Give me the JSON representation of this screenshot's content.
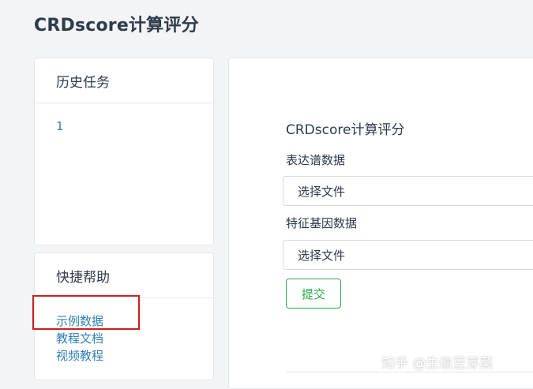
{
  "page": {
    "title": "CRDscore计算评分"
  },
  "history": {
    "title": "历史任务",
    "items": [
      "1"
    ]
  },
  "help": {
    "title": "快捷帮助",
    "links": [
      "示例数据",
      "教程文档",
      "视频教程"
    ]
  },
  "form": {
    "title": "CRDscore计算评分",
    "expression_label": "表达谱数据",
    "expression_button": "选择文件",
    "gene_label": "特征基因数据",
    "gene_button": "选择文件",
    "submit_label": "提交"
  },
  "watermark": "知乎 @生信豆芽菜",
  "colors": {
    "link": "#2f7fb8",
    "submit": "#2aa84a",
    "highlight": "#cc1f1f",
    "background": "#f3f4f6"
  }
}
